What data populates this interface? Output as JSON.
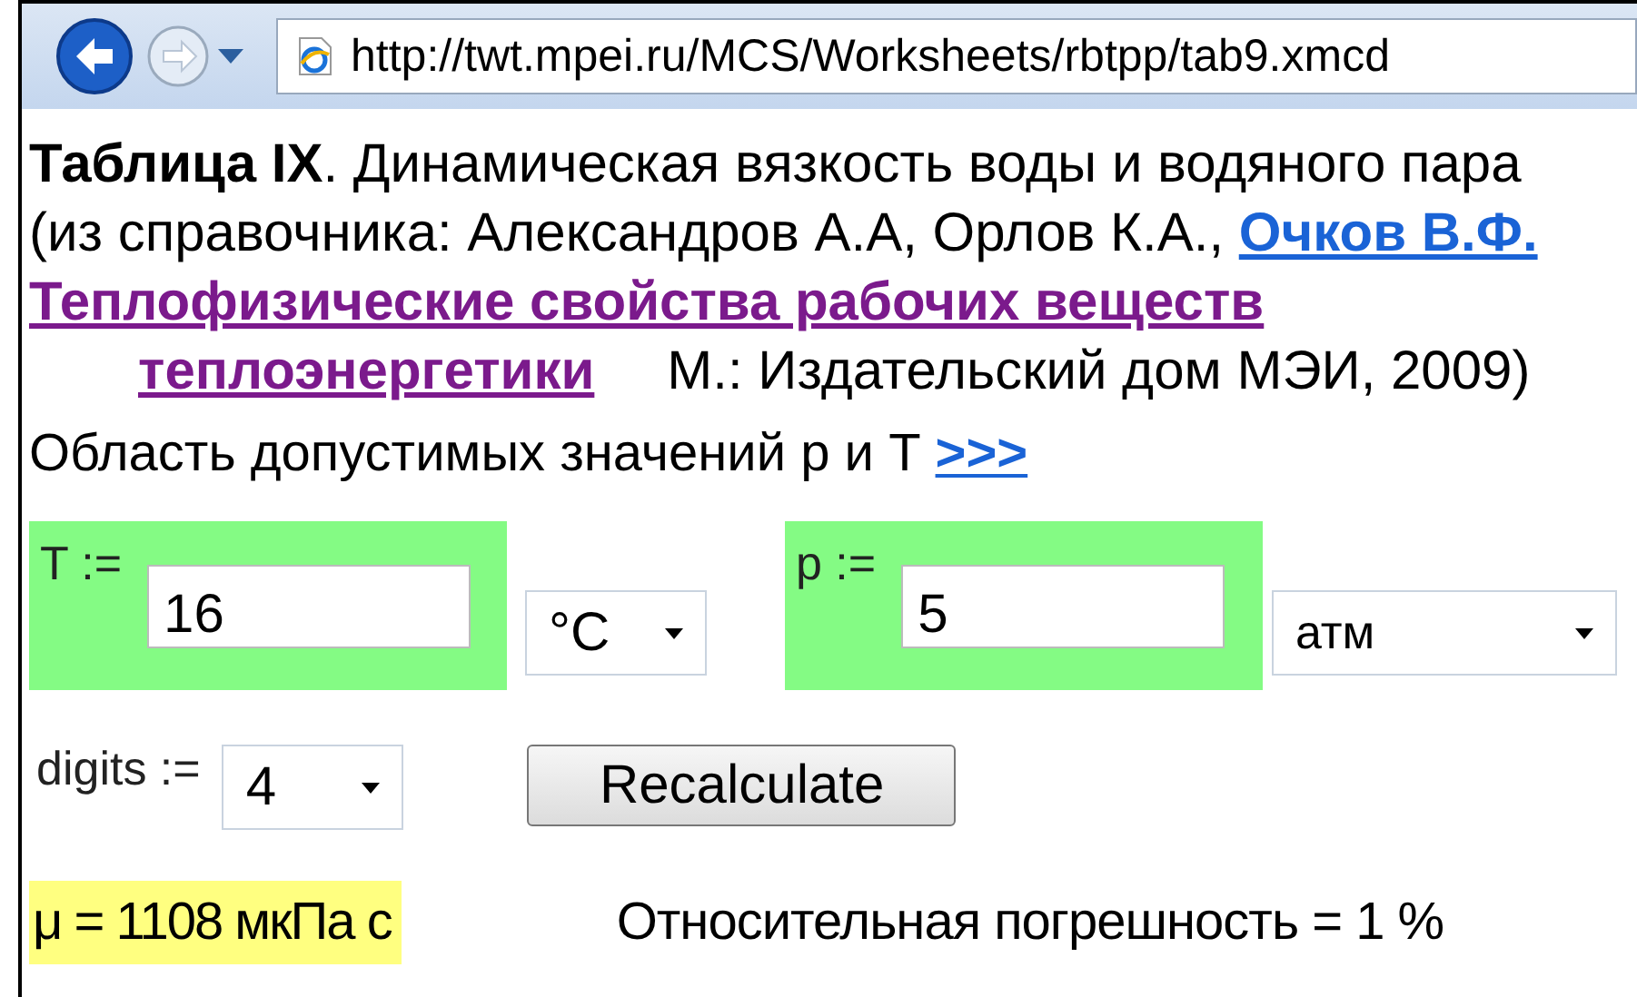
{
  "browser": {
    "url": "http://twt.mpei.ru/MCS/Worksheets/rbtpp/tab9.xmcd"
  },
  "citation": [
    {
      "indent": false,
      "segments": [
        {
          "kind": "bold",
          "text": "Таблица IX"
        },
        {
          "kind": "text",
          "text": ". Динамическая вязкость воды и водяного пара"
        }
      ]
    },
    {
      "indent": false,
      "segments": [
        {
          "kind": "text",
          "text": "(из справочника: Александров А.А, Орлов К.А., "
        },
        {
          "kind": "link",
          "text": "Очков В.Ф."
        }
      ]
    },
    {
      "indent": false,
      "segments": [
        {
          "kind": "visited",
          "text": "Теплофизические свойства рабочих веществ"
        }
      ]
    },
    {
      "indent": true,
      "segments": [
        {
          "kind": "visited",
          "text": "теплоэнергетики"
        },
        {
          "kind": "text",
          "text": "М.: Издательский дом МЭИ, 2009)"
        }
      ]
    }
  ],
  "range": {
    "text": "Область допустимых значений p и T",
    "link": ">>>"
  },
  "inputs": [
    {
      "label": "T :=",
      "value": "16",
      "unit": "°C"
    },
    {
      "label": "p :=",
      "value": "5",
      "unit": "атм"
    }
  ],
  "digits": {
    "label": "digits :=",
    "value": "4"
  },
  "button": "Recalculate",
  "result": {
    "value": "μ = 1108 мкПа с",
    "error": "Относительная погрешность = 1 %"
  }
}
